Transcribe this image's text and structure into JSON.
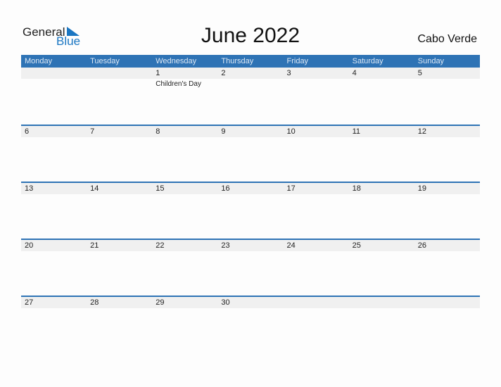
{
  "logo": {
    "general": "General",
    "blue": "Blue"
  },
  "title": "June 2022",
  "country": "Cabo Verde",
  "colors": {
    "accent": "#2e73b5",
    "date_strip": "#f0f0f0"
  },
  "weekdays": [
    "Monday",
    "Tuesday",
    "Wednesday",
    "Thursday",
    "Friday",
    "Saturday",
    "Sunday"
  ],
  "weeks": [
    {
      "days": [
        "",
        "",
        "1",
        "2",
        "3",
        "4",
        "5"
      ],
      "events": [
        "",
        "",
        "Children's Day",
        "",
        "",
        "",
        ""
      ]
    },
    {
      "days": [
        "6",
        "7",
        "8",
        "9",
        "10",
        "11",
        "12"
      ],
      "events": [
        "",
        "",
        "",
        "",
        "",
        "",
        ""
      ]
    },
    {
      "days": [
        "13",
        "14",
        "15",
        "16",
        "17",
        "18",
        "19"
      ],
      "events": [
        "",
        "",
        "",
        "",
        "",
        "",
        ""
      ]
    },
    {
      "days": [
        "20",
        "21",
        "22",
        "23",
        "24",
        "25",
        "26"
      ],
      "events": [
        "",
        "",
        "",
        "",
        "",
        "",
        ""
      ]
    },
    {
      "days": [
        "27",
        "28",
        "29",
        "30",
        "",
        "",
        ""
      ],
      "events": [
        "",
        "",
        "",
        "",
        "",
        "",
        ""
      ]
    }
  ]
}
